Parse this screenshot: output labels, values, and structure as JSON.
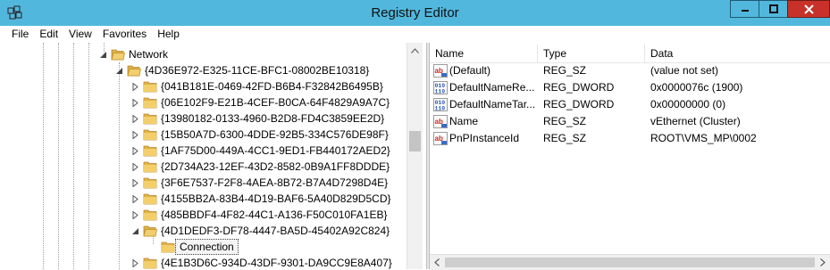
{
  "window": {
    "title": "Registry Editor"
  },
  "menu": [
    "File",
    "Edit",
    "View",
    "Favorites",
    "Help"
  ],
  "tree": {
    "network": "Network",
    "parent_guid": "{4D36E972-E325-11CE-BFC1-08002BE10318}",
    "children": [
      "{041B181E-0469-42FD-B6B4-F32842B6495B}",
      "{06E102F9-E21B-4CEF-B0CA-64F4829A9A7C}",
      "{13980182-0133-4960-B2D8-FD4C3859EE2D}",
      "{15B50A7D-6300-4DDE-92B5-334C576DE98F}",
      "{1AF75D00-449A-4CC1-9ED1-FB440172AED2}",
      "{2D734A23-12EF-43D2-8582-0B9A1FF8DDDE}",
      "{3F6E7537-F2F8-4AEA-8B72-B7A4D7298D4E}",
      "{4155BB2A-83B4-4D19-BAF6-5A40D829D5CD}",
      "{485BBDF4-4F82-44C1-A136-F50C010FA1EB}",
      "{4D1DEDF3-DF78-4447-BA5D-45402A92C824}"
    ],
    "selected": "Connection",
    "after": "{4E1B3D6C-934D-43DF-9301-DA9CC9E8A407}"
  },
  "values": {
    "headers": {
      "name": "Name",
      "type": "Type",
      "data": "Data"
    },
    "rows": [
      {
        "icon": "string-value-icon",
        "name": "(Default)",
        "type": "REG_SZ",
        "data": "(value not set)"
      },
      {
        "icon": "binary-value-icon",
        "name": "DefaultNameRe...",
        "type": "REG_DWORD",
        "data": "0x0000076c (1900)"
      },
      {
        "icon": "binary-value-icon",
        "name": "DefaultNameTar...",
        "type": "REG_DWORD",
        "data": "0x00000000 (0)"
      },
      {
        "icon": "string-value-icon",
        "name": "Name",
        "type": "REG_SZ",
        "data": "vEthernet (Cluster)"
      },
      {
        "icon": "string-value-icon",
        "name": "PnPInstanceId",
        "type": "REG_SZ",
        "data": "ROOT\\VMS_MP\\0002"
      }
    ]
  },
  "colors": {
    "titlebar": "#52b7dd",
    "close": "#c7312a",
    "folder": "#e3b34a"
  }
}
